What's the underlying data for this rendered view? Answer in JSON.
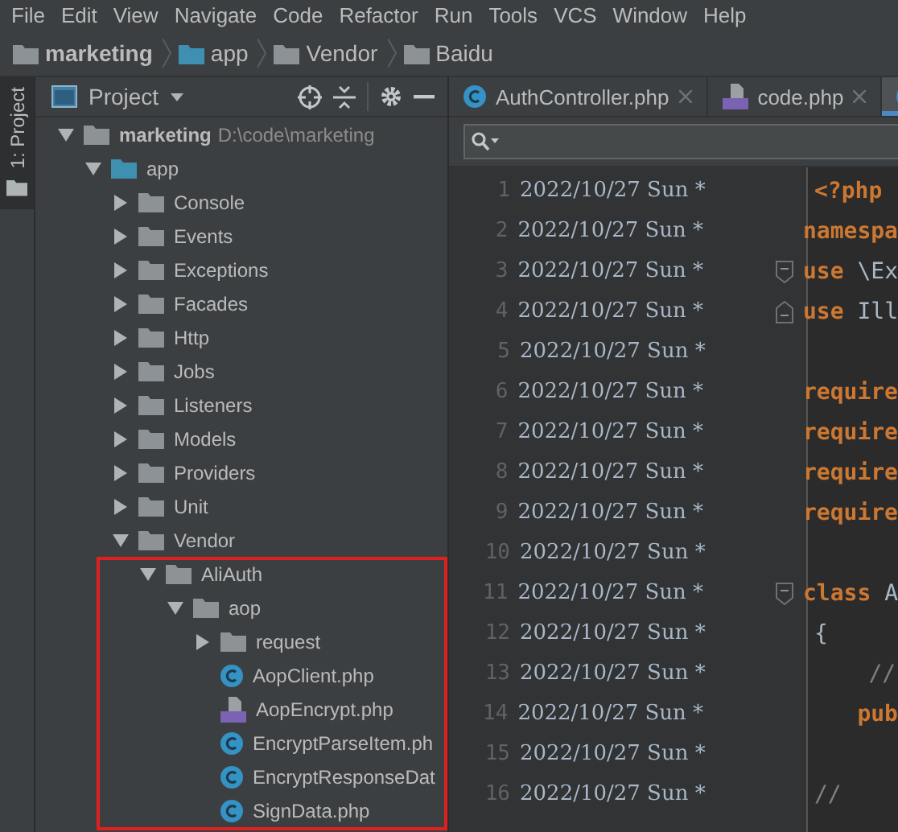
{
  "menu": [
    "File",
    "Edit",
    "View",
    "Navigate",
    "Code",
    "Refactor",
    "Run",
    "Tools",
    "VCS",
    "Window",
    "Help"
  ],
  "breadcrumb": [
    {
      "label": "marketing",
      "kind": "folder"
    },
    {
      "label": "app",
      "kind": "source-folder"
    },
    {
      "label": "Vendor",
      "kind": "folder"
    },
    {
      "label": "Baidu",
      "kind": "folder"
    }
  ],
  "side_stripe": {
    "label": "1: Project",
    "selected": true
  },
  "project_panel": {
    "title": "Project",
    "tree": [
      {
        "label": "marketing",
        "path": "D:\\code\\marketing",
        "kind": "folder",
        "expanded": true,
        "children": [
          {
            "label": "app",
            "kind": "source-folder",
            "expanded": true,
            "children": [
              {
                "label": "Console",
                "kind": "folder",
                "expanded": false
              },
              {
                "label": "Events",
                "kind": "folder",
                "expanded": false
              },
              {
                "label": "Exceptions",
                "kind": "folder",
                "expanded": false
              },
              {
                "label": "Facades",
                "kind": "folder",
                "expanded": false
              },
              {
                "label": "Http",
                "kind": "folder",
                "expanded": false
              },
              {
                "label": "Jobs",
                "kind": "folder",
                "expanded": false
              },
              {
                "label": "Listeners",
                "kind": "folder",
                "expanded": false
              },
              {
                "label": "Models",
                "kind": "folder",
                "expanded": false
              },
              {
                "label": "Providers",
                "kind": "folder",
                "expanded": false
              },
              {
                "label": "Unit",
                "kind": "folder",
                "expanded": false
              },
              {
                "label": "Vendor",
                "kind": "folder",
                "expanded": true,
                "children": [
                  {
                    "label": "AliAuth",
                    "kind": "folder",
                    "expanded": true,
                    "children": [
                      {
                        "label": "aop",
                        "kind": "folder",
                        "expanded": true,
                        "children": [
                          {
                            "label": "request",
                            "kind": "folder",
                            "expanded": false
                          },
                          {
                            "label": "AopClient.php",
                            "kind": "class"
                          },
                          {
                            "label": "AopEncrypt.php",
                            "kind": "php"
                          },
                          {
                            "label": "EncryptParseItem.ph",
                            "kind": "class"
                          },
                          {
                            "label": "EncryptResponseDat",
                            "kind": "class"
                          },
                          {
                            "label": "SignData.php",
                            "kind": "class"
                          }
                        ]
                      }
                    ]
                  }
                ]
              }
            ]
          }
        ]
      }
    ]
  },
  "editor": {
    "tabs": [
      {
        "label": "AuthController.php",
        "kind": "class",
        "selected": false
      },
      {
        "label": "code.php",
        "kind": "php",
        "selected": false
      },
      {
        "kind": "class",
        "selected": true
      }
    ],
    "lines": [
      {
        "number": "1",
        "annotation": "2022/10/27 Sun *",
        "code": [
          {
            "text": "<?php",
            "kind": "keyword"
          }
        ]
      },
      {
        "number": "2",
        "annotation": "2022/10/27 Sun *",
        "code": [
          {
            "text": "namespa",
            "kind": "keyword"
          }
        ]
      },
      {
        "number": "3",
        "annotation": "2022/10/27 Sun *",
        "fold_start": true,
        "code": [
          {
            "text": "use",
            "kind": "keyword"
          },
          {
            "text": " \\Ex",
            "kind": "plain"
          }
        ]
      },
      {
        "number": "4",
        "annotation": "2022/10/27 Sun *",
        "fold_end": true,
        "code": [
          {
            "text": "use",
            "kind": "keyword"
          },
          {
            "text": " Ill",
            "kind": "plain"
          }
        ]
      },
      {
        "number": "5",
        "annotation": "2022/10/27 Sun *"
      },
      {
        "number": "6",
        "annotation": "2022/10/27 Sun *",
        "code": [
          {
            "text": "require",
            "kind": "keyword"
          }
        ]
      },
      {
        "number": "7",
        "annotation": "2022/10/27 Sun *",
        "code": [
          {
            "text": "require",
            "kind": "keyword"
          }
        ]
      },
      {
        "number": "8",
        "annotation": "2022/10/27 Sun *",
        "code": [
          {
            "text": "require",
            "kind": "keyword"
          }
        ]
      },
      {
        "number": "9",
        "annotation": "2022/10/27 Sun *",
        "code": [
          {
            "text": "require",
            "kind": "keyword"
          }
        ]
      },
      {
        "number": "10",
        "annotation": "2022/10/27 Sun *"
      },
      {
        "number": "11",
        "annotation": "2022/10/27 Sun *",
        "fold_start": true,
        "code": [
          {
            "text": "class",
            "kind": "keyword"
          },
          {
            "text": " A",
            "kind": "plain"
          }
        ]
      },
      {
        "number": "12",
        "annotation": "2022/10/27 Sun *",
        "code": [
          {
            "text": "{",
            "kind": "plain"
          }
        ]
      },
      {
        "number": "13",
        "annotation": "2022/10/27 Sun *",
        "code": [
          {
            "text": "    //",
            "kind": "comment"
          }
        ]
      },
      {
        "number": "14",
        "annotation": "2022/10/27 Sun *",
        "code": [
          {
            "text": "    pub",
            "kind": "keyword"
          }
        ]
      },
      {
        "number": "15",
        "annotation": "2022/10/27 Sun *"
      },
      {
        "number": "16",
        "annotation": "2022/10/27 Sun *",
        "code": [
          {
            "text": "//",
            "kind": "comment"
          }
        ]
      }
    ]
  }
}
